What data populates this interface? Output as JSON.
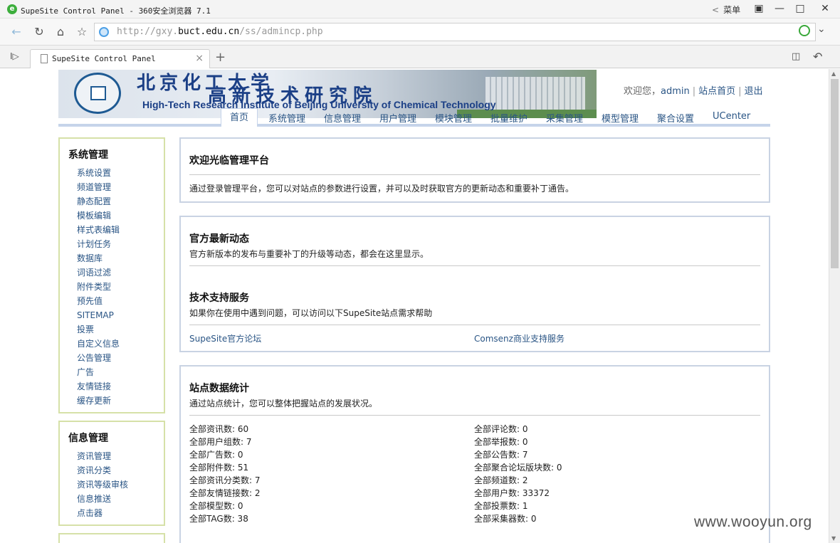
{
  "browser": {
    "window_title": "SupeSite Control Panel - 360安全浏览器 7.1",
    "menu_label": "菜单",
    "url_prefix": "http://gxy.",
    "url_domain": "buct.edu.cn",
    "url_path": "/ss/admincp.php",
    "tab_title": "SupeSite Control Panel"
  },
  "header": {
    "banner_cn_line1": "北京化工大学",
    "banner_cn_line2": "高新技术研究院",
    "banner_en": "High-Tech Research Institute of Beijing University of Chemical Technology",
    "welcome": "欢迎您，",
    "username": "admin",
    "home_link": "站点首页",
    "logout_link": "退出"
  },
  "nav": {
    "items": [
      "首页",
      "系统管理",
      "信息管理",
      "用户管理",
      "模块管理",
      "批量维护",
      "采集管理",
      "模型管理",
      "聚合设置",
      "UCenter"
    ]
  },
  "sidebar": {
    "sections": [
      {
        "title": "系统管理",
        "items": [
          "系统设置",
          "频道管理",
          "静态配置",
          "模板编辑",
          "样式表编辑",
          "计划任务",
          "数据库",
          "词语过滤",
          "附件类型",
          "预先值",
          "SITEMAP",
          "投票",
          "自定义信息",
          "公告管理",
          "广告",
          "友情链接",
          "缓存更新"
        ]
      },
      {
        "title": "信息管理",
        "items": [
          "资讯管理",
          "资讯分类",
          "资讯等级审核",
          "信息推送",
          "点击器"
        ]
      }
    ]
  },
  "welcome_box": {
    "title": "欢迎光临管理平台",
    "desc": "通过登录管理平台，您可以对站点的参数进行设置，并可以及时获取官方的更新动态和重要补丁通告。"
  },
  "news_box": {
    "title": "官方最新动态",
    "desc": "官方新版本的发布与重要补丁的升级等动态，都会在这里显示。",
    "support_title": "技术支持服务",
    "support_desc": "如果你在使用中遇到问题，可以访问以下SupeSite站点需求帮助",
    "link_forum": "SupeSite官方论坛",
    "link_commercial": "Comsenz商业支持服务"
  },
  "stats_box": {
    "title": "站点数据统计",
    "desc": "通过站点统计，您可以整体把握站点的发展状况。",
    "left": [
      "全部资讯数: 60",
      "全部用户组数: 7",
      "全部广告数: 0",
      "全部附件数: 51",
      "全部资讯分类数: 7",
      "全部友情链接数: 2",
      "全部模型数: 0",
      "全部TAG数: 38"
    ],
    "right": [
      "全部评论数: 0",
      "全部举报数: 0",
      "全部公告数: 7",
      "全部聚合论坛版块数: 0",
      "全部频道数: 2",
      "全部用户数: 33372",
      "全部投票数: 1",
      "全部采集器数: 0"
    ]
  },
  "watermark": "www.wooyun.org"
}
